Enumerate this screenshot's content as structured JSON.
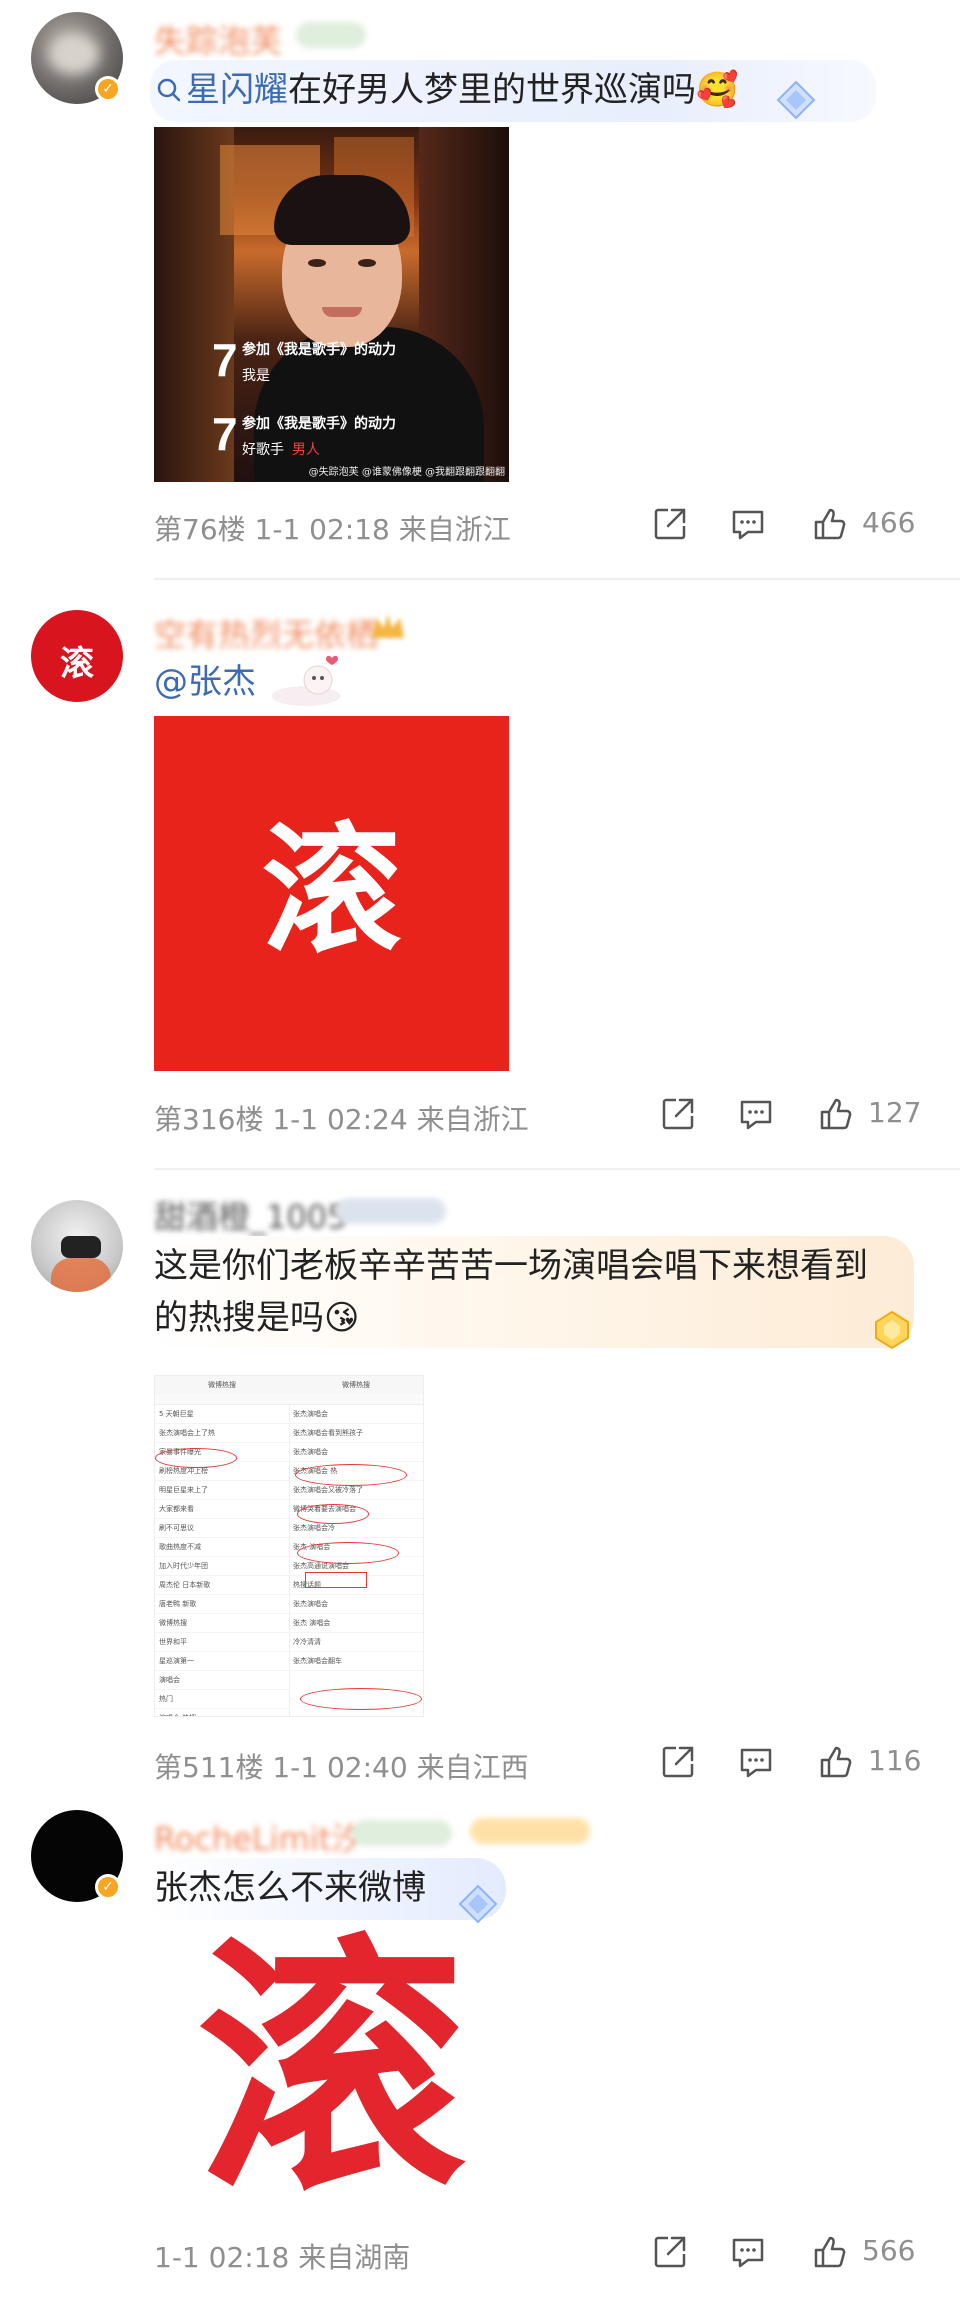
{
  "comments": [
    {
      "username": "失踪泡芙",
      "topic": "星闪耀",
      "text": "在好男人梦里的世界巡演吗",
      "emoji": "🥰",
      "image": {
        "caption1_num": "7",
        "caption1_line": "参加《我是歌手》的动力",
        "caption1_sub": "我是",
        "caption2_num": "7",
        "caption2_line": "参加《我是歌手》的动力",
        "caption2_sub": "好歌手",
        "caption2_sub_red": "男人",
        "watermark": "@失踪泡芙 @谁蒙佛像梗 @我翻跟翻跟翻翻"
      },
      "floor": "第76楼",
      "time": "1-1 02:18",
      "location": "来自浙江",
      "likes": "466"
    },
    {
      "username": "空有热烈无依栖",
      "text": "@张杰",
      "image": {
        "glyph": "滚"
      },
      "avatar_glyph": "滚",
      "floor": "第316楼",
      "time": "1-1 02:24",
      "location": "来自浙江",
      "likes": "127"
    },
    {
      "username": "甜酒橙_1005",
      "text": "这是你们老板辛辛苦苦一场演唱会唱下来想看到的热搜是吗",
      "emoji": "😘",
      "image": {
        "left_title": "微博热搜",
        "right_title": "微博热搜",
        "left_rows": [
          "5 天朝巨星",
          "张杰演唱会上了热",
          "家暴事件曝光",
          "刷榜热度冲上榜",
          "明星巨星来上了",
          "大家都来看",
          "刷不可思议",
          "歌曲热度不减",
          "加入时代少年团",
          "周杰伦 日本新歌",
          "唐老鸭 新歌",
          "微博热搜",
          "世界和平",
          "星巡演第一",
          "演唱会",
          "热门",
          "演唱会 热搜"
        ],
        "right_rows": [
          "张杰演唱会",
          "张杰演唱会看到熊孩子",
          "张杰演唱会",
          "张杰演唱会 热",
          "张杰演唱会又被冷落了",
          "微博哭着要去演唱会",
          "张杰演唱会冷",
          "张杰 演唱会",
          "张杰高通说演唱会",
          "热搜话题",
          "张杰演唱会",
          "张杰 演唱会",
          "冷冷清清",
          "张杰演唱会翻车"
        ]
      },
      "floor": "第511楼",
      "time": "1-1 02:40",
      "location": "来自江西",
      "likes": "116"
    },
    {
      "username": "RocheLimit汐",
      "text": "张杰怎么不来微博",
      "image": {
        "glyph": "滚"
      },
      "floor": "",
      "time": "1-1 02:18",
      "location": "来自湖南",
      "likes": "566"
    }
  ],
  "icons": {
    "share": "share-icon",
    "comment": "comment-icon",
    "like": "like-icon",
    "search": "search-icon",
    "verified": "verified-badge-icon"
  },
  "colors": {
    "topic_link": "#3d6bb3",
    "meta_gray": "#8f8f8f",
    "red_image": "#e8231c",
    "username": "#f08a5d"
  }
}
